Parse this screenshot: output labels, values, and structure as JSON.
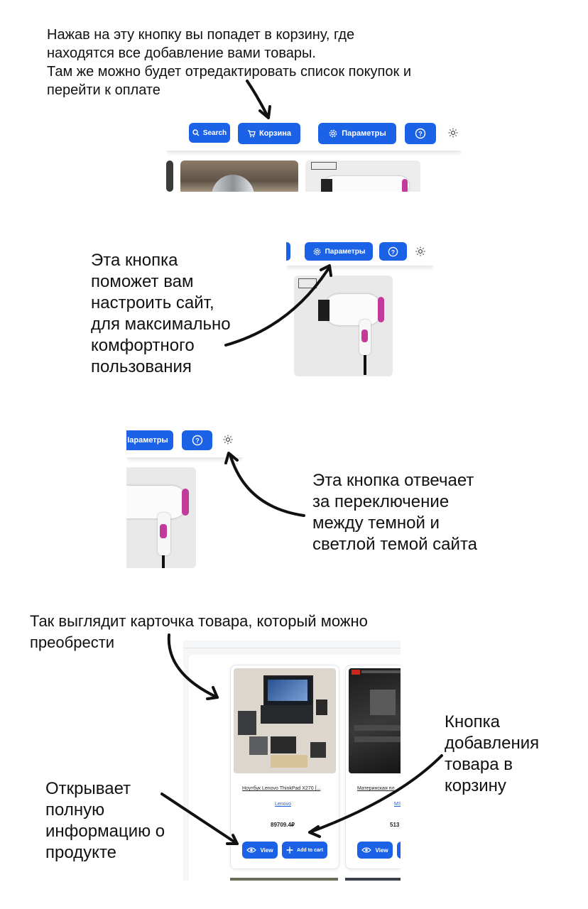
{
  "annotations": {
    "cart_note": "Нажав на эту кнопку вы попадет в корзину, где\nнаходятся все добавление вами товары.\nТам же можно будет отредактировать список покупок и\nперейти к оплате",
    "settings_note": "Эта кнопка\nпоможет вам\nнастроить сайт,\nдля максимально\nкомфортного\nпользования",
    "theme_note": "Эта кнопка отвечает\nза переключение\nмежду темной и\nсветлой темой сайта",
    "card_note": "Так выглядит карточка товара, который можно\nпреобрести",
    "add_to_cart_note": "Кнопка\nдобавления\nтовара в\nкорзину",
    "view_note": "Открывает\nполную\nинформацию о\nпродукте"
  },
  "header": {
    "search_label": "Search",
    "cart_label": "Корзина",
    "settings_label": "Параметры",
    "settings_label_cropped": "Iараметры"
  },
  "product_card": {
    "title": "Ноутбук Lenovo ThinkPad X270 [...",
    "brand": "Lenovo",
    "price": "89709.4₽",
    "view_label": "View",
    "add_label": "Add to cart"
  },
  "product_card_2": {
    "title": "Материнская пл",
    "brand": "MS",
    "price": "513",
    "view_label": "View"
  },
  "colors": {
    "accent": "#1c62e6",
    "text": "#111111"
  },
  "icons": [
    "search-icon",
    "cart-icon",
    "gear-icon",
    "help-icon",
    "sun-icon",
    "eye-icon",
    "plus-icon"
  ]
}
